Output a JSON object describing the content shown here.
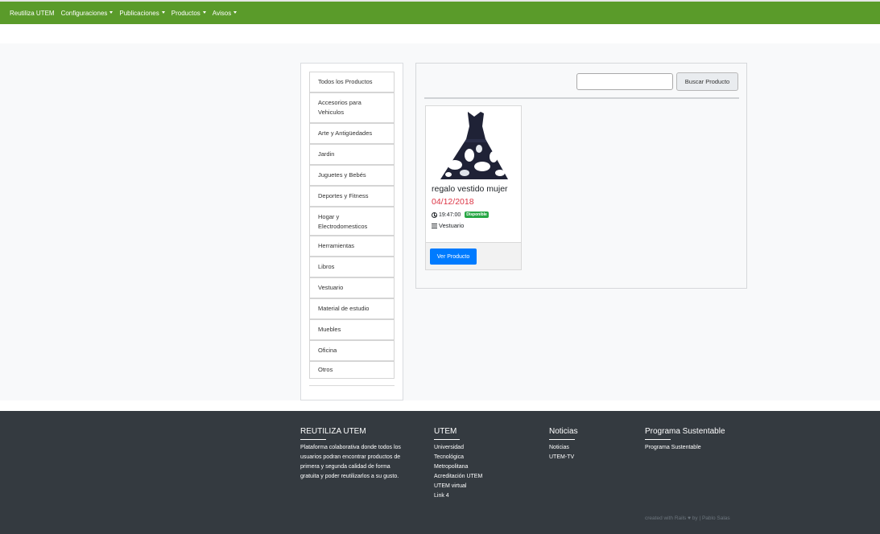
{
  "navbar": {
    "brand": "Reutiliza UTEM",
    "items": [
      {
        "label": "Configuraciones"
      },
      {
        "label": "Publicaciones"
      },
      {
        "label": "Productos"
      },
      {
        "label": "Avisos"
      }
    ]
  },
  "sidebar": {
    "categories": [
      {
        "label": "Todos los Productos"
      },
      {
        "label": "Accesorios para Vehiculos"
      },
      {
        "label": "Arte y Antigüedades"
      },
      {
        "label": "Jardin"
      },
      {
        "label": "Juguetes y Bebés"
      },
      {
        "label": "Deportes y Fitness"
      },
      {
        "label": "Hogar y Electrodomesticos"
      },
      {
        "label": "Herramientas"
      },
      {
        "label": "Libros"
      },
      {
        "label": "Vestuario"
      },
      {
        "label": "Material de estudio"
      },
      {
        "label": "Muebles"
      },
      {
        "label": "Oficina"
      },
      {
        "label": "Otros"
      }
    ]
  },
  "search": {
    "value": "",
    "button_label": "Buscar Producto"
  },
  "product": {
    "title": "regalo vestido mujer",
    "date": "04/12/2018",
    "time": "19:47:00",
    "status": "Disponible",
    "category": "Vestuario",
    "button_label": "Ver Producto",
    "image_icon": "dress-image"
  },
  "footer": {
    "col1": {
      "title": "REUTILIZA UTEM",
      "text": "Plataforma colaborativa donde todos los usuarios podran encontrar productos de primera y segunda calidad de forma gratuita y poder reutilizarlos a su gusto."
    },
    "col2": {
      "title": "UTEM",
      "links": [
        "Universidad",
        "Tecnológica",
        "Metropolitana",
        "Acreditación UTEM",
        "UTEM virtual",
        "Link 4"
      ]
    },
    "col3": {
      "title": "Noticias",
      "links": [
        "Noticias",
        "UTEM-TV"
      ]
    },
    "col4": {
      "title": "Programa Sustentable",
      "links": [
        "Programa Sustentable"
      ]
    },
    "credit_prefix": "created with Rails",
    "credit_suffix": "by | Pablo Salas"
  },
  "colors": {
    "navbar": "#5a9b2a",
    "footer": "#343a40",
    "primary": "#007bff",
    "date": "#dc3545",
    "badge": "#28a745"
  }
}
